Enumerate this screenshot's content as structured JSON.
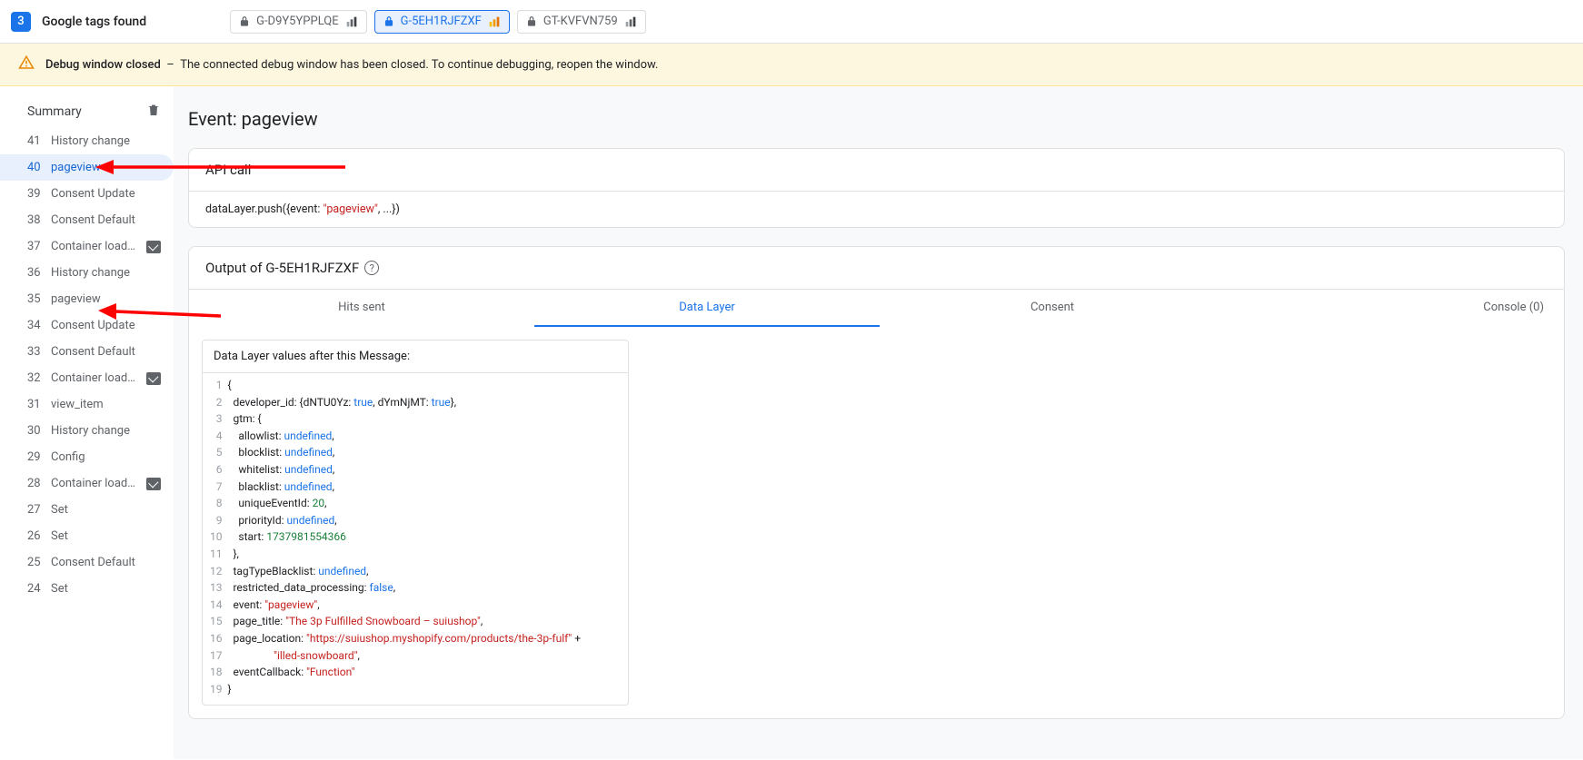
{
  "header": {
    "badge": "3",
    "title": "Google tags found",
    "chips": [
      {
        "id": "G-D9Y5YPPLQE",
        "active": false,
        "iconColor": "#5f6368"
      },
      {
        "id": "G-5EH1RJFZXF",
        "active": true,
        "iconColor": "#f29900"
      },
      {
        "id": "GT-KVFVN759",
        "active": false,
        "iconColor": "#5f6368"
      }
    ]
  },
  "alert": {
    "title": "Debug window closed",
    "sep": "–",
    "body": "The connected debug window has been closed. To continue debugging, reopen the window."
  },
  "sidebar": {
    "heading": "Summary",
    "items": [
      {
        "num": "41",
        "label": "History change"
      },
      {
        "num": "40",
        "label": "pageview",
        "active": true
      },
      {
        "num": "39",
        "label": "Consent Update"
      },
      {
        "num": "38",
        "label": "Consent Default"
      },
      {
        "num": "37",
        "label": "Container loaded",
        "badge": true
      },
      {
        "num": "36",
        "label": "History change"
      },
      {
        "num": "35",
        "label": "pageview"
      },
      {
        "num": "34",
        "label": "Consent Update"
      },
      {
        "num": "33",
        "label": "Consent Default"
      },
      {
        "num": "32",
        "label": "Container loaded",
        "badge": true
      },
      {
        "num": "31",
        "label": "view_item"
      },
      {
        "num": "30",
        "label": "History change"
      },
      {
        "num": "29",
        "label": "Config"
      },
      {
        "num": "28",
        "label": "Container loaded",
        "badge": true
      },
      {
        "num": "27",
        "label": "Set"
      },
      {
        "num": "26",
        "label": "Set"
      },
      {
        "num": "25",
        "label": "Consent Default"
      },
      {
        "num": "24",
        "label": "Set"
      }
    ]
  },
  "content": {
    "pageTitle": "Event: pageview",
    "apiCall": {
      "heading": "API call",
      "code_prefix": "dataLayer.push({event: ",
      "code_string": "\"pageview\"",
      "code_suffix": ", ...})"
    },
    "output": {
      "heading": "Output of G-5EH1RJFZXF",
      "tabs": [
        "Hits sent",
        "Data Layer",
        "Consent",
        "Console (0)"
      ],
      "activeTab": 1,
      "dataLayer": {
        "title": "Data Layer values after this Message:",
        "lines": [
          [
            {
              "t": "{"
            }
          ],
          [
            {
              "t": "  developer_id: {dNTU0Yz: "
            },
            {
              "t": "true",
              "c": "kw"
            },
            {
              "t": ", dYmNjMT: "
            },
            {
              "t": "true",
              "c": "kw"
            },
            {
              "t": "},"
            }
          ],
          [
            {
              "t": "  gtm: {"
            }
          ],
          [
            {
              "t": "    allowlist: "
            },
            {
              "t": "undefined",
              "c": "kw"
            },
            {
              "t": ","
            }
          ],
          [
            {
              "t": "    blocklist: "
            },
            {
              "t": "undefined",
              "c": "kw"
            },
            {
              "t": ","
            }
          ],
          [
            {
              "t": "    whitelist: "
            },
            {
              "t": "undefined",
              "c": "kw"
            },
            {
              "t": ","
            }
          ],
          [
            {
              "t": "    blacklist: "
            },
            {
              "t": "undefined",
              "c": "kw"
            },
            {
              "t": ","
            }
          ],
          [
            {
              "t": "    uniqueEventId: "
            },
            {
              "t": "20",
              "c": "num"
            },
            {
              "t": ","
            }
          ],
          [
            {
              "t": "    priorityId: "
            },
            {
              "t": "undefined",
              "c": "kw"
            },
            {
              "t": ","
            }
          ],
          [
            {
              "t": "    start: "
            },
            {
              "t": "1737981554366",
              "c": "num"
            }
          ],
          [
            {
              "t": "  },"
            }
          ],
          [
            {
              "t": "  tagTypeBlacklist: "
            },
            {
              "t": "undefined",
              "c": "kw"
            },
            {
              "t": ","
            }
          ],
          [
            {
              "t": "  restricted_data_processing: "
            },
            {
              "t": "false",
              "c": "kw"
            },
            {
              "t": ","
            }
          ],
          [
            {
              "t": "  event: "
            },
            {
              "t": "\"pageview\"",
              "c": "str"
            },
            {
              "t": ","
            }
          ],
          [
            {
              "t": "  page_title: "
            },
            {
              "t": "\"The 3p Fulfilled Snowboard – suiushop\"",
              "c": "str"
            },
            {
              "t": ","
            }
          ],
          [
            {
              "t": "  page_location: "
            },
            {
              "t": "\"https://suiushop.myshopify.com/products/the-3p-fulf\"",
              "c": "str"
            },
            {
              "t": " +"
            }
          ],
          [
            {
              "t": "                 "
            },
            {
              "t": "\"illed-snowboard\"",
              "c": "str"
            },
            {
              "t": ","
            }
          ],
          [
            {
              "t": "  eventCallback: "
            },
            {
              "t": "\"Function\"",
              "c": "str"
            }
          ],
          [
            {
              "t": "}"
            }
          ]
        ]
      }
    }
  }
}
